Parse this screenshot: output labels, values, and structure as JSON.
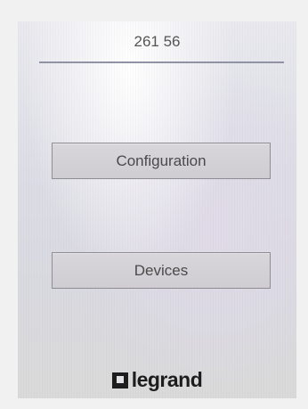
{
  "header": {
    "value": "261 56"
  },
  "menu": {
    "configuration_label": "Configuration",
    "devices_label": "Devices"
  },
  "brand": {
    "name": "legrand"
  }
}
